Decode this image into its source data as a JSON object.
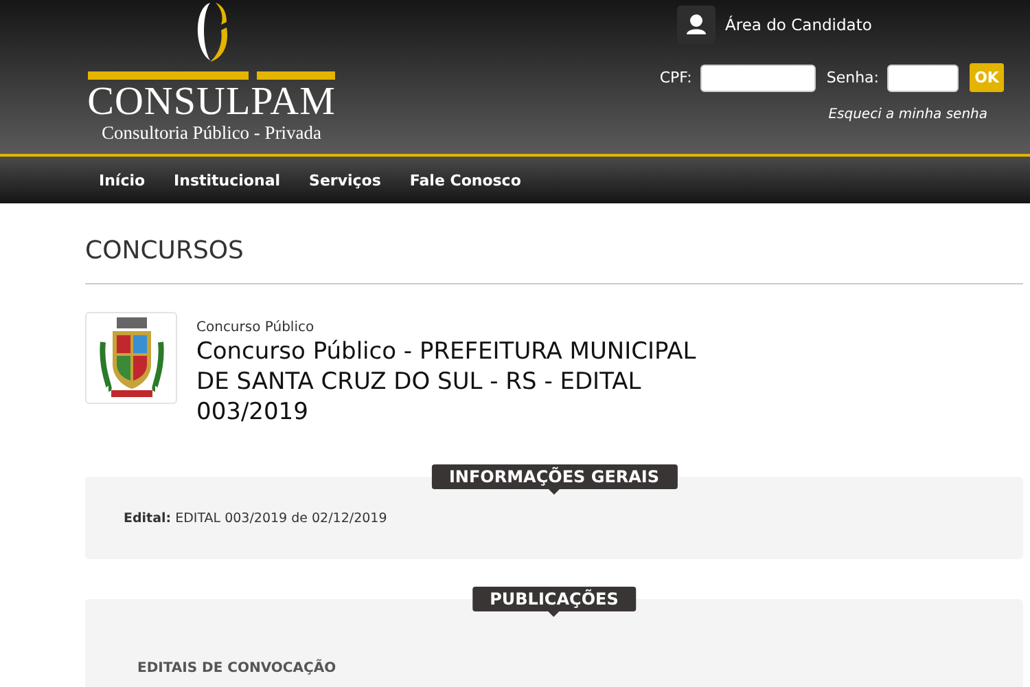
{
  "header": {
    "logo": {
      "name": "CONSULPAM",
      "tagline": "Consultoria Público - Privada"
    },
    "candidate_area": {
      "label": "Área do Candidato"
    },
    "login": {
      "cpf_label": "CPF:",
      "password_label": "Senha:",
      "submit": "OK",
      "forgot_link": "Esqueci a minha senha"
    }
  },
  "nav": {
    "items": [
      {
        "label": "Início"
      },
      {
        "label": "Institucional"
      },
      {
        "label": "Serviços"
      },
      {
        "label": "Fale Conosco"
      }
    ]
  },
  "page_title": "CONCURSOS",
  "contest": {
    "category": "Concurso Público",
    "title": "Concurso Público - PREFEITURA MUNICIPAL DE SANTA CRUZ DO SUL - RS - EDITAL 003/2019"
  },
  "sections": [
    {
      "heading": "INFORMAÇÕES GERAIS",
      "lines": [
        "**Edital:** EDITAL 003/2019 de 02/12/2019"
      ]
    },
    {
      "heading": "PUBLICAÇÕES",
      "subheadings": [
        "EDITAIS DE CONVOCAÇÃO"
      ]
    }
  ]
}
